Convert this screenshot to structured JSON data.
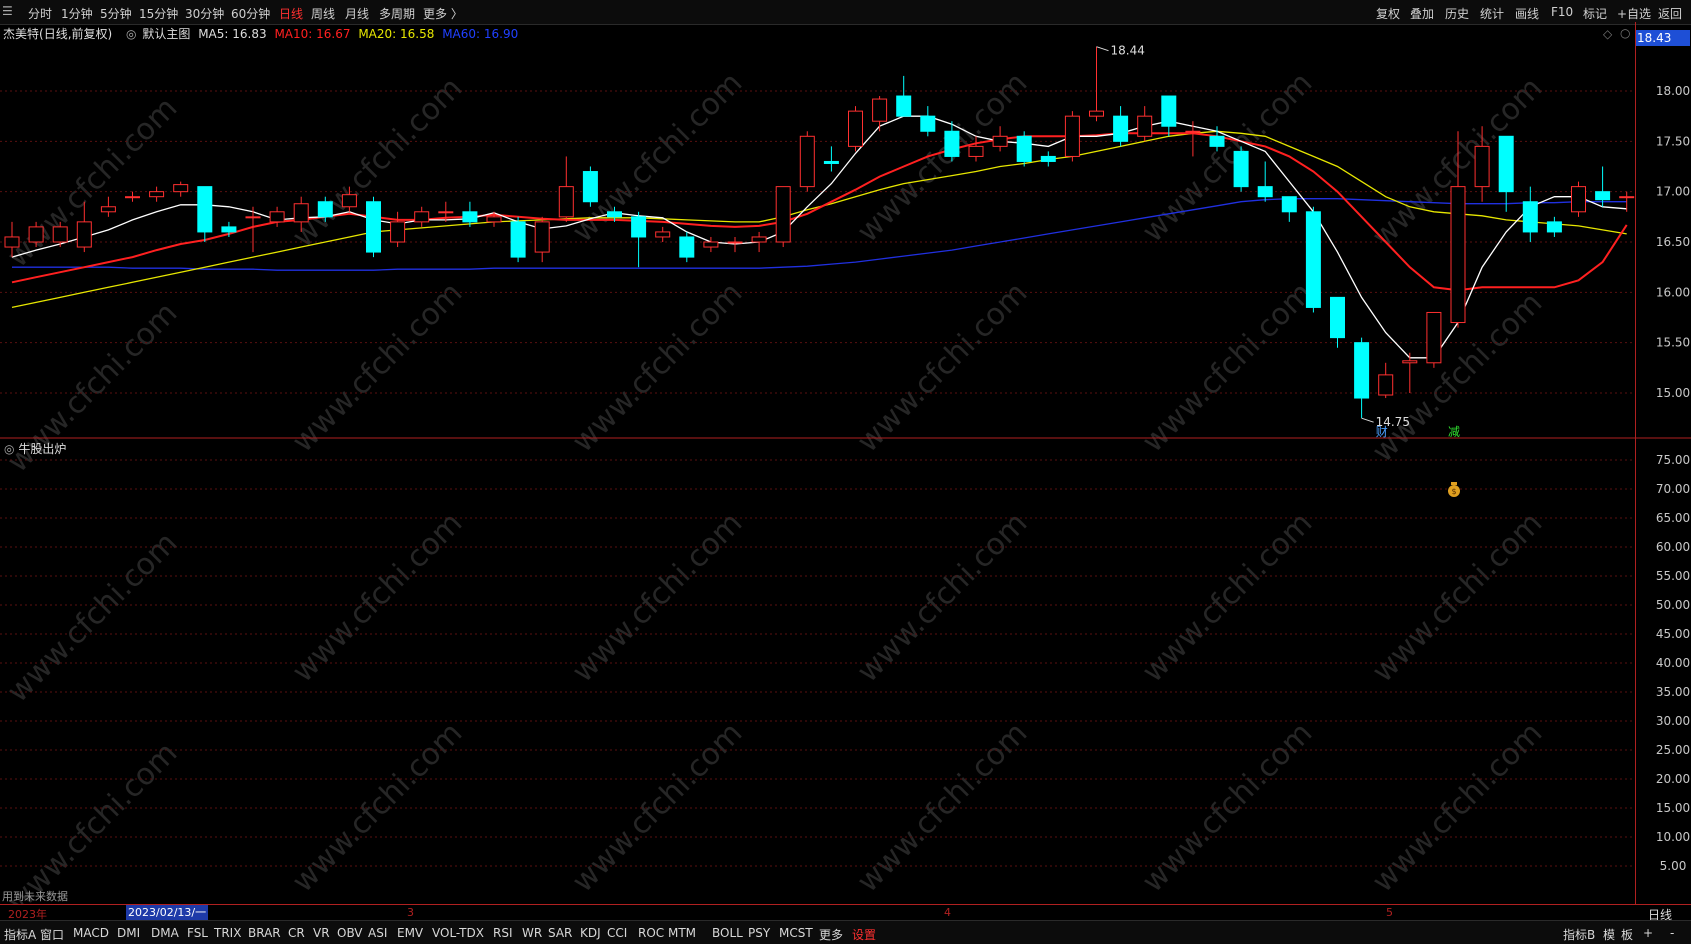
{
  "toolbar": {
    "menu_icon": "menu-icon",
    "periods": [
      "分时",
      "1分钟",
      "5分钟",
      "15分钟",
      "30分钟",
      "60分钟",
      "日线",
      "周线",
      "月线",
      "多周期",
      "更多 〉"
    ],
    "active_period": "日线",
    "actions": [
      "复权",
      "叠加",
      "历史",
      "统计",
      "画线",
      "F10",
      "标记",
      "+自选",
      "返回"
    ]
  },
  "stock": {
    "name": "杰美特",
    "mode": "(日线,前复权)",
    "chart_label": "默认主图",
    "ma5": "MA5: 16.83",
    "ma10": "MA10: 16.67",
    "ma20": "MA20: 16.58",
    "ma60": "MA60: 16.90",
    "last_price": "18.43"
  },
  "colors": {
    "up": "#ff3030",
    "down": "#00ffff",
    "ma5": "#ffffff",
    "ma10": "#ff2020",
    "ma20": "#e6e600",
    "ma60": "#2030e0",
    "axis": "#b02020",
    "active_tab": "#ff3030"
  },
  "chart_data": [
    {
      "type": "candlestick",
      "y_ticks": [
        "18.00",
        "17.50",
        "17.00",
        "16.50",
        "16.00",
        "15.50",
        "15.00"
      ],
      "ylim": [
        14.6,
        18.6
      ],
      "high_annotation": "18.44",
      "low_annotation": "14.75",
      "event_markers": [
        "财",
        "减"
      ],
      "candles": [
        {
          "o": 16.45,
          "c": 16.55,
          "h": 16.7,
          "l": 16.35
        },
        {
          "o": 16.5,
          "c": 16.65,
          "h": 16.7,
          "l": 16.45
        },
        {
          "o": 16.5,
          "c": 16.65,
          "h": 16.7,
          "l": 16.45
        },
        {
          "o": 16.45,
          "c": 16.7,
          "h": 16.9,
          "l": 16.4
        },
        {
          "o": 16.8,
          "c": 16.85,
          "h": 16.95,
          "l": 16.75
        },
        {
          "o": 16.95,
          "c": 16.95,
          "h": 17.0,
          "l": 16.9
        },
        {
          "o": 16.95,
          "c": 17.0,
          "h": 17.05,
          "l": 16.9
        },
        {
          "o": 17.0,
          "c": 17.07,
          "h": 17.1,
          "l": 16.95
        },
        {
          "o": 17.05,
          "c": 16.6,
          "h": 17.05,
          "l": 16.5
        },
        {
          "o": 16.65,
          "c": 16.6,
          "h": 16.7,
          "l": 16.55
        },
        {
          "o": 16.75,
          "c": 16.75,
          "h": 16.85,
          "l": 16.4
        },
        {
          "o": 16.7,
          "c": 16.8,
          "h": 16.85,
          "l": 16.65
        },
        {
          "o": 16.7,
          "c": 16.88,
          "h": 16.95,
          "l": 16.6
        },
        {
          "o": 16.9,
          "c": 16.75,
          "h": 16.95,
          "l": 16.7
        },
        {
          "o": 16.85,
          "c": 16.97,
          "h": 17.05,
          "l": 16.8
        },
        {
          "o": 16.9,
          "c": 16.4,
          "h": 16.95,
          "l": 16.35
        },
        {
          "o": 16.5,
          "c": 16.7,
          "h": 16.8,
          "l": 16.45
        },
        {
          "o": 16.7,
          "c": 16.8,
          "h": 16.85,
          "l": 16.65
        },
        {
          "o": 16.8,
          "c": 16.8,
          "h": 16.9,
          "l": 16.7
        },
        {
          "o": 16.8,
          "c": 16.7,
          "h": 16.9,
          "l": 16.65
        },
        {
          "o": 16.7,
          "c": 16.75,
          "h": 16.8,
          "l": 16.65
        },
        {
          "o": 16.7,
          "c": 16.35,
          "h": 16.75,
          "l": 16.3
        },
        {
          "o": 16.4,
          "c": 16.7,
          "h": 16.75,
          "l": 16.3
        },
        {
          "o": 16.75,
          "c": 17.05,
          "h": 17.35,
          "l": 16.7
        },
        {
          "o": 17.2,
          "c": 16.9,
          "h": 17.25,
          "l": 16.85
        },
        {
          "o": 16.8,
          "c": 16.75,
          "h": 16.85,
          "l": 16.7
        },
        {
          "o": 16.75,
          "c": 16.55,
          "h": 16.8,
          "l": 16.25
        },
        {
          "o": 16.55,
          "c": 16.6,
          "h": 16.65,
          "l": 16.5
        },
        {
          "o": 16.55,
          "c": 16.35,
          "h": 16.6,
          "l": 16.3
        },
        {
          "o": 16.45,
          "c": 16.5,
          "h": 16.55,
          "l": 16.4
        },
        {
          "o": 16.5,
          "c": 16.5,
          "h": 16.55,
          "l": 16.4
        },
        {
          "o": 16.5,
          "c": 16.55,
          "h": 16.6,
          "l": 16.4
        },
        {
          "o": 16.5,
          "c": 17.05,
          "h": 17.05,
          "l": 16.45
        },
        {
          "o": 17.05,
          "c": 17.55,
          "h": 17.6,
          "l": 17.0
        },
        {
          "o": 17.3,
          "c": 17.28,
          "h": 17.45,
          "l": 17.2
        },
        {
          "o": 17.45,
          "c": 17.8,
          "h": 17.85,
          "l": 17.4
        },
        {
          "o": 17.7,
          "c": 17.92,
          "h": 17.95,
          "l": 17.6
        },
        {
          "o": 17.95,
          "c": 17.75,
          "h": 18.15,
          "l": 17.75
        },
        {
          "o": 17.75,
          "c": 17.6,
          "h": 17.85,
          "l": 17.55
        },
        {
          "o": 17.6,
          "c": 17.35,
          "h": 17.7,
          "l": 17.3
        },
        {
          "o": 17.35,
          "c": 17.45,
          "h": 17.55,
          "l": 17.3
        },
        {
          "o": 17.45,
          "c": 17.55,
          "h": 17.65,
          "l": 17.4
        },
        {
          "o": 17.55,
          "c": 17.3,
          "h": 17.6,
          "l": 17.25
        },
        {
          "o": 17.35,
          "c": 17.3,
          "h": 17.4,
          "l": 17.25
        },
        {
          "o": 17.35,
          "c": 17.75,
          "h": 17.8,
          "l": 17.3
        },
        {
          "o": 17.75,
          "c": 17.8,
          "h": 18.44,
          "l": 17.7
        },
        {
          "o": 17.75,
          "c": 17.5,
          "h": 17.85,
          "l": 17.45
        },
        {
          "o": 17.55,
          "c": 17.75,
          "h": 17.85,
          "l": 17.5
        },
        {
          "o": 17.95,
          "c": 17.65,
          "h": 17.95,
          "l": 17.55
        },
        {
          "o": 17.6,
          "c": 17.6,
          "h": 17.7,
          "l": 17.35
        },
        {
          "o": 17.55,
          "c": 17.45,
          "h": 17.65,
          "l": 17.4
        },
        {
          "o": 17.4,
          "c": 17.05,
          "h": 17.45,
          "l": 17.0
        },
        {
          "o": 17.05,
          "c": 16.95,
          "h": 17.3,
          "l": 16.9
        },
        {
          "o": 16.95,
          "c": 16.8,
          "h": 16.95,
          "l": 16.7
        },
        {
          "o": 16.8,
          "c": 15.85,
          "h": 16.85,
          "l": 15.8
        },
        {
          "o": 15.95,
          "c": 15.55,
          "h": 15.95,
          "l": 15.45
        },
        {
          "o": 15.5,
          "c": 14.95,
          "h": 15.55,
          "l": 14.75
        },
        {
          "o": 14.98,
          "c": 15.18,
          "h": 15.3,
          "l": 14.95
        },
        {
          "o": 15.3,
          "c": 15.32,
          "h": 15.4,
          "l": 15.0
        },
        {
          "o": 15.3,
          "c": 15.8,
          "h": 15.8,
          "l": 15.25
        },
        {
          "o": 15.7,
          "c": 17.05,
          "h": 17.6,
          "l": 15.65
        },
        {
          "o": 17.05,
          "c": 17.45,
          "h": 17.65,
          "l": 16.9
        },
        {
          "o": 17.55,
          "c": 17.0,
          "h": 17.55,
          "l": 16.8
        },
        {
          "o": 16.9,
          "c": 16.6,
          "h": 17.05,
          "l": 16.5
        },
        {
          "o": 16.7,
          "c": 16.6,
          "h": 16.75,
          "l": 16.55
        },
        {
          "o": 16.8,
          "c": 17.05,
          "h": 17.1,
          "l": 16.75
        },
        {
          "o": 17.0,
          "c": 16.92,
          "h": 17.25,
          "l": 16.85
        },
        {
          "o": 16.95,
          "c": 16.95,
          "h": 17.0,
          "l": 16.8
        }
      ],
      "ma5": [
        16.35,
        16.42,
        16.48,
        16.55,
        16.62,
        16.72,
        16.8,
        16.87,
        16.87,
        16.85,
        16.8,
        16.72,
        16.74,
        16.75,
        16.8,
        16.72,
        16.68,
        16.72,
        16.72,
        16.73,
        16.79,
        16.7,
        16.63,
        16.66,
        16.73,
        16.79,
        16.76,
        16.74,
        16.6,
        16.5,
        16.48,
        16.5,
        16.6,
        16.85,
        17.08,
        17.38,
        17.65,
        17.75,
        17.75,
        17.67,
        17.55,
        17.5,
        17.48,
        17.45,
        17.55,
        17.55,
        17.58,
        17.65,
        17.7,
        17.65,
        17.6,
        17.5,
        17.4,
        17.1,
        16.8,
        16.4,
        15.95,
        15.6,
        15.35,
        15.35,
        15.7,
        16.25,
        16.6,
        16.85,
        16.95,
        16.95,
        16.85,
        16.83
      ],
      "ma10": [
        16.1,
        16.15,
        16.2,
        16.25,
        16.3,
        16.35,
        16.42,
        16.48,
        16.52,
        16.58,
        16.65,
        16.7,
        16.72,
        16.75,
        16.78,
        16.75,
        16.72,
        16.72,
        16.74,
        16.75,
        16.77,
        16.75,
        16.73,
        16.72,
        16.72,
        16.72,
        16.71,
        16.7,
        16.68,
        16.66,
        16.65,
        16.66,
        16.7,
        16.78,
        16.9,
        17.02,
        17.15,
        17.25,
        17.35,
        17.42,
        17.48,
        17.52,
        17.55,
        17.55,
        17.55,
        17.56,
        17.58,
        17.58,
        17.58,
        17.58,
        17.55,
        17.5,
        17.45,
        17.35,
        17.2,
        17.0,
        16.75,
        16.5,
        16.25,
        16.05,
        16.02,
        16.05,
        16.05,
        16.05,
        16.05,
        16.12,
        16.3,
        16.67
      ],
      "ma20": [
        15.85,
        15.9,
        15.95,
        16.0,
        16.05,
        16.1,
        16.15,
        16.2,
        16.25,
        16.3,
        16.35,
        16.4,
        16.45,
        16.5,
        16.55,
        16.6,
        16.62,
        16.64,
        16.66,
        16.68,
        16.7,
        16.71,
        16.72,
        16.73,
        16.74,
        16.74,
        16.74,
        16.73,
        16.72,
        16.71,
        16.7,
        16.7,
        16.75,
        16.82,
        16.88,
        16.95,
        17.02,
        17.08,
        17.12,
        17.16,
        17.2,
        17.25,
        17.28,
        17.32,
        17.35,
        17.4,
        17.45,
        17.5,
        17.55,
        17.58,
        17.6,
        17.58,
        17.55,
        17.45,
        17.35,
        17.25,
        17.1,
        16.95,
        16.85,
        16.8,
        16.78,
        16.76,
        16.72,
        16.7,
        16.68,
        16.66,
        16.62,
        16.58
      ],
      "ma60": [
        16.25,
        16.25,
        16.25,
        16.25,
        16.25,
        16.24,
        16.24,
        16.24,
        16.23,
        16.23,
        16.23,
        16.22,
        16.22,
        16.22,
        16.22,
        16.22,
        16.23,
        16.23,
        16.23,
        16.23,
        16.24,
        16.24,
        16.24,
        16.24,
        16.24,
        16.24,
        16.24,
        16.24,
        16.24,
        16.24,
        16.24,
        16.24,
        16.25,
        16.26,
        16.28,
        16.3,
        16.33,
        16.36,
        16.39,
        16.42,
        16.46,
        16.5,
        16.54,
        16.58,
        16.62,
        16.66,
        16.7,
        16.74,
        16.78,
        16.82,
        16.86,
        16.9,
        16.92,
        16.93,
        16.93,
        16.93,
        16.92,
        16.91,
        16.9,
        16.89,
        16.88,
        16.88,
        16.88,
        16.89,
        16.89,
        16.9,
        16.9,
        16.9
      ]
    },
    {
      "type": "indicator",
      "title": "牛股出炉",
      "y_ticks": [
        "75.00",
        "70.00",
        "65.00",
        "60.00",
        "55.00",
        "50.00",
        "45.00",
        "40.00",
        "35.00",
        "30.00",
        "25.00",
        "20.00",
        "15.00",
        "10.00",
        "5.00"
      ],
      "ylim": [
        0,
        78
      ],
      "signal": {
        "candle_index": 60,
        "value": 70.0,
        "icon": "money-bag-icon"
      }
    }
  ],
  "sub_panel": {
    "title": "牛股出炉",
    "future_note": "用到未来数据"
  },
  "datebar": {
    "year": "2023年",
    "current_date": "2023/02/13/一",
    "month_marks": [
      "3",
      "4",
      "5"
    ],
    "period": "日线"
  },
  "bottombar": {
    "indicators": [
      "指标A",
      "窗口",
      "MACD",
      "DMI",
      "DMA",
      "FSL",
      "TRIX",
      "BRAR",
      "CR",
      "VR",
      "OBV",
      "ASI",
      "EMV",
      "VOL-TDX",
      "RSI",
      "WR",
      "SAR",
      "KDJ",
      "CCI",
      "ROC",
      "MTM",
      "BOLL",
      "PSY",
      "MCST",
      "更多",
      "设置"
    ],
    "right": [
      "指标B",
      "模",
      "板",
      "+",
      "-"
    ]
  },
  "watermark": "www.cfchi.com"
}
